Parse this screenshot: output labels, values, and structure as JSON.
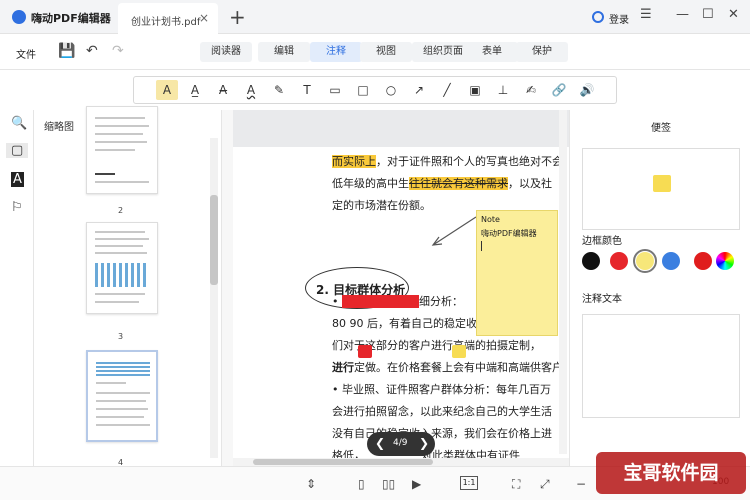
{
  "titlebar": {
    "app_name": "嗨动PDF编辑器",
    "tab_label": "创业计划书.pdf",
    "tab_close": "×",
    "new_tab": "+",
    "login": "登录",
    "menu_glyph": "☰",
    "minimize_glyph": "—",
    "maximize_glyph": "☐",
    "close_glyph": "✕"
  },
  "toolbar": {
    "file_label": "文件",
    "save_glyph": "💾",
    "undo_glyph": "↶",
    "redo_glyph": "↷",
    "modes": [
      {
        "label": "阅读器"
      },
      {
        "label": "编辑"
      },
      {
        "label": "注释",
        "active": true
      },
      {
        "label": "视图"
      },
      {
        "label": "组织页面"
      },
      {
        "label": "表单"
      },
      {
        "label": "保护"
      }
    ]
  },
  "annot_tools": [
    {
      "name": "highlight-tool-icon",
      "glyph": "A",
      "active": true
    },
    {
      "name": "underline-tool-icon",
      "glyph": "A̲"
    },
    {
      "name": "strikethrough-tool-icon",
      "glyph": "A̶"
    },
    {
      "name": "squiggly-tool-icon",
      "glyph": "A"
    },
    {
      "name": "pen-tool-icon",
      "glyph": "✎"
    },
    {
      "name": "text-tool-icon",
      "glyph": "T"
    },
    {
      "name": "note-tool-icon",
      "glyph": "▭"
    },
    {
      "name": "rectangle-tool-icon",
      "glyph": "□"
    },
    {
      "name": "ellipse-tool-icon",
      "glyph": "○"
    },
    {
      "name": "arrow-tool-icon",
      "glyph": "↗"
    },
    {
      "name": "line-tool-icon",
      "glyph": "╱"
    },
    {
      "name": "image-tool-icon",
      "glyph": "▣"
    },
    {
      "name": "stamp-tool-icon",
      "glyph": "⊥"
    },
    {
      "name": "signature-tool-icon",
      "glyph": "✍"
    },
    {
      "name": "link-tool-icon",
      "glyph": "🔗"
    },
    {
      "name": "audio-tool-icon",
      "glyph": "🔊"
    }
  ],
  "sidebar": {
    "search_glyph": "🔍",
    "page_glyph": "▢",
    "text_glyph": "A",
    "bookmark_glyph": "⚐",
    "thumb_title": "缩略图",
    "thumb_labels": [
      "2",
      "3",
      "4"
    ],
    "current_page": 3
  },
  "document": {
    "line1_a": "而实际上",
    "line1_b": "，对于证件照和个人的写真也绝对不会",
    "line2_a": "低年级的高中生",
    "line2_b": "往往就会有这种需求",
    "line2_c": "，以及社",
    "line3": "定的市场潜在份额。",
    "heading": "2. 目标群体分析",
    "bullet1_a": "• ",
    "bullet1_b": "婚纱照客户群体",
    "bullet1_c": "细分析：",
    "line5": "80 90 后，有着自己的稳定收入",
    "line6": "们对于这部分的客户进行高端的拍摄定制，",
    "line7_a": "进行",
    "line7_b": "定做。在价格套餐上会有中端和高端供客户",
    "bullet2": "• 毕业照、证件照客户群体分析：每年几百万",
    "line9": "会进行拍照留念，以此来纪念自己的大学生活",
    "line10": "没有自己的稳定收入来源，我们会在价格上进",
    "line11": "格低，",
    "line11_b": "对此类群体中有证件",
    "note_title": "Note",
    "note_author": "嗨动PDF编辑器",
    "page_label": "4/9",
    "prev_glyph": "❮",
    "next_glyph": "❯"
  },
  "right_panel": {
    "title": "便签",
    "border_color_label": "边框颜色",
    "annot_text_label": "注释文本",
    "swatches": [
      "#111111",
      "#e6262b",
      "#f7e77a",
      "#3b7fe0",
      "#e01d1d",
      "#f2f2f2"
    ],
    "selected_swatch": 2
  },
  "status_bar": {
    "fit_glyph": "⇕",
    "single_glyph": "▯",
    "double_glyph": "▯▯",
    "play_glyph": "▶",
    "zoom_label": "1:1",
    "crop_glyph": "⛶",
    "fullscreen_glyph": "⤢",
    "zoom_out_glyph": "−",
    "zoom_value": "100"
  },
  "watermark": "宝哥软件园"
}
